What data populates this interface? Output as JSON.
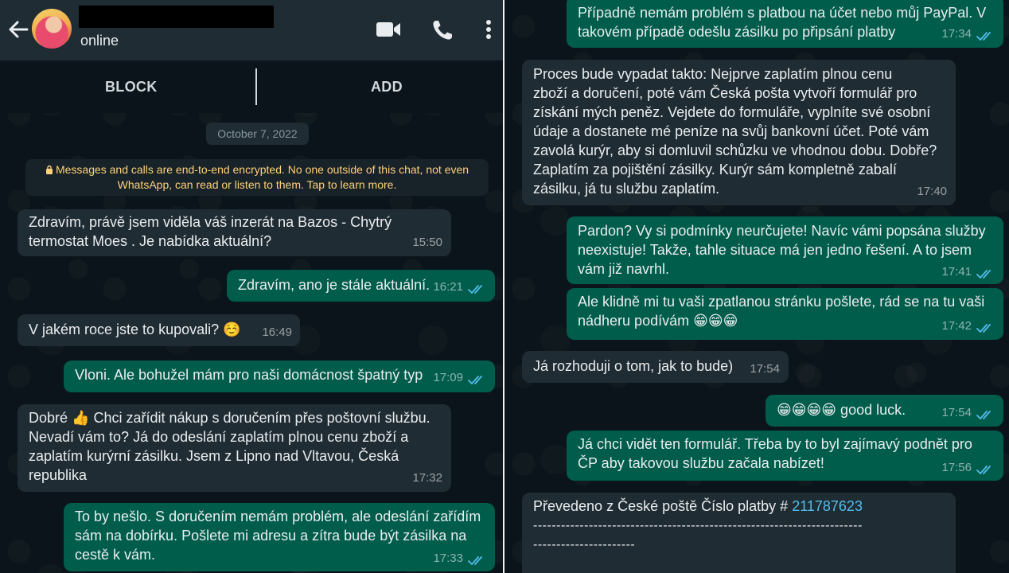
{
  "header": {
    "status": "online"
  },
  "actions": {
    "block": "BLOCK",
    "add": "ADD"
  },
  "date_chip": "October 7, 2022",
  "encryption_notice": "Messages and calls are end-to-end encrypted. No one outside of this chat, not even WhatsApp, can read or listen to them. Tap to learn more.",
  "left_messages": [
    {
      "text": "Zdravím, právě jsem viděla váš inzerát na Bazos - Chytrý\ntermostat Moes . Je nabídka aktuální?",
      "time": "15:50"
    },
    {
      "text": "Zdravím, ano je stále aktuální.",
      "time": "16:21"
    },
    {
      "text": "V jakém roce jste to kupovali? ☺️",
      "time": "16:49"
    },
    {
      "text": "Vloni. Ale bohužel mám pro naši domácnost špatný typ",
      "time": "17:09"
    },
    {
      "text": "Dobré 👍 Chci zařídit nákup s doručením přes poštovní službu.\nNevadí vám to? Já do odeslání zaplatím plnou cenu zboží a\nzaplatím kurýrní zásilku. Jsem z Lipno nad Vltavou, Česká\nrepublika",
      "time": "17:32"
    },
    {
      "text": "To by nešlo. S doručením nemám problém, ale odeslání zařídím\nsám na dobírku. Pošlete mi adresu a zítra bude být zásilka na\ncestě k vám.",
      "time": "17:33"
    }
  ],
  "right_messages": [
    {
      "text": "Případně nemám problém s platbou na účet nebo můj PayPal. V\ntakovém případě odešlu zásilku po připsání platby",
      "time": "17:34"
    },
    {
      "text": "Proces bude vypadat takto: Nejprve zaplatím plnou cenu\nzboží a doručení, poté vám Česká pošta vytvoří formulář pro\nzískání mých peněz. Vejdete do formuláře, vyplníte své osobní\núdaje a dostanete mé peníze na svůj bankovní účet. Poté vám\nzavolá kurýr, aby si domluvil schůzku ve vhodnou dobu. Dobře?\nZaplatím za pojištění zásilky. Kurýr sám kompletně zabalí\nzásilku, já tu službu zaplatím.",
      "time": "17:40"
    },
    {
      "text": "Pardon? Vy si podmínky neurčujete! Navíc vámi popsána služby\nneexistuje! Takže, tahle situace má jen jedno řešení. A to jsem\nvám již navrhl.",
      "time": "17:41"
    },
    {
      "text": "Ale klidně mi tu vaši zpatlanou stránku pošlete, rád se na tu vaši\nnádheru podívám 😁😁😁",
      "time": "17:42"
    },
    {
      "text": "Já rozhoduji o tom, jak to bude)",
      "time": "17:54"
    },
    {
      "text": "😁😁😁😁 good luck.",
      "time": "17:54"
    },
    {
      "text": "Já chci vidět ten formulář. Třeba by to byl zajímavý podnět pro\nČP aby takovou službu začala nabízet!",
      "time": "17:56"
    },
    {
      "text_prefix": "Převedeno z  České poště Číslo platby # ",
      "payment_number": "211787623",
      "dashes_line1": "-----------------------------------------------------------------------",
      "dashes_line2": "----------------------"
    }
  ],
  "icons": [
    "back-arrow-icon",
    "video-call-icon",
    "voice-call-icon",
    "more-options-icon",
    "double-check-icon",
    "lock-icon"
  ],
  "colors": {
    "incoming_bubble": "#202c33",
    "outgoing_bubble": "#005c4b",
    "read_ticks": "#53bdeb",
    "background": "#0b141a"
  }
}
